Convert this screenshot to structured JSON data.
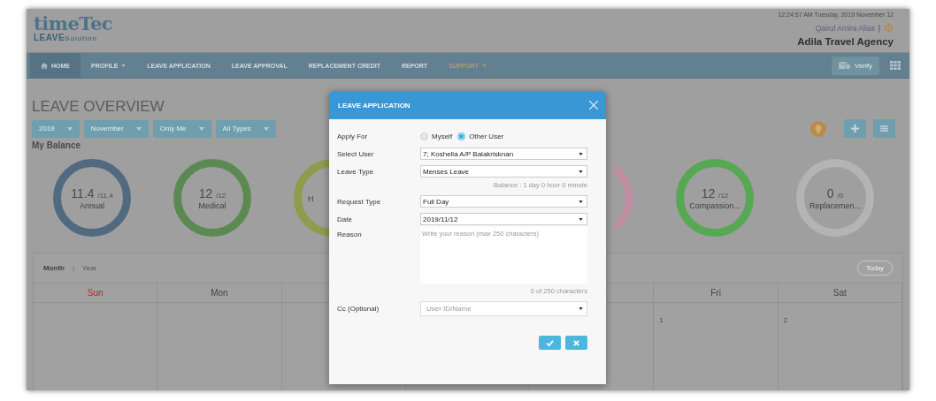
{
  "header": {
    "logo_top": "timeTec",
    "logo_bottom": "LEAVE",
    "logo_suffix": "Solution",
    "datetime": "12:24:57 AM Tuesday, 2019 November 12",
    "user": "Qairul Amira Alias",
    "separator": "|",
    "company": "Adila Travel Agency"
  },
  "nav": {
    "items": [
      {
        "label": "HOME",
        "selected": true,
        "kind": "home"
      },
      {
        "label": "PROFILE",
        "selected": false,
        "kind": "menu"
      },
      {
        "label": "LEAVE APPLICATION",
        "selected": false,
        "kind": "link"
      },
      {
        "label": "LEAVE APPROVAL",
        "selected": false,
        "kind": "link"
      },
      {
        "label": "REPLACEMENT CREDIT",
        "selected": false,
        "kind": "link"
      },
      {
        "label": "REPORT",
        "selected": false,
        "kind": "link"
      },
      {
        "label": "SUPPORT",
        "selected": false,
        "kind": "support"
      }
    ],
    "verify": "Verify"
  },
  "page": {
    "title": "LEAVE OVERVIEW",
    "filters": [
      "2019",
      "November",
      "Only Me",
      "All Types"
    ],
    "balance_title": "My Balance",
    "balances_left": [
      {
        "value": "11.4",
        "total": "/11.4",
        "label": "Annual",
        "color": "#526a80",
        "kind": "full"
      },
      {
        "value": "12",
        "total": "/12",
        "label": "Medical",
        "color": "#5a8a52",
        "kind": "full"
      },
      {
        "label": "H",
        "color": "#8e9c4e",
        "kind": "partial"
      }
    ],
    "balances_right": [
      {
        "color": "#c08ea3",
        "kind": "hidden"
      },
      {
        "value": "12",
        "total": "/12",
        "label": "Compassion...",
        "color": "#56a852",
        "kind": "full"
      },
      {
        "value": "0",
        "total": "/0",
        "label": "Replacemen...",
        "color": "#b4b4b4",
        "kind": "full"
      }
    ]
  },
  "calendar": {
    "views": [
      {
        "label": "Month",
        "selected": true
      },
      {
        "label": "Year",
        "selected": false
      }
    ],
    "separator": "|",
    "today": "Today",
    "days_left": [
      {
        "label": "Sun",
        "weekend": true
      },
      {
        "label": "Mon",
        "weekend": false
      }
    ],
    "days_right": [
      {
        "label": "Fri",
        "weekend": false,
        "date": "1"
      },
      {
        "label": "Sat",
        "weekend": false,
        "date": "2"
      }
    ]
  },
  "dialog": {
    "title": "LEAVE APPLICATION",
    "apply_for": {
      "label": "Apply For",
      "options": [
        {
          "label": "Myself",
          "selected": false,
          "disabled": true
        },
        {
          "label": "Other User",
          "selected": true,
          "disabled": false
        }
      ]
    },
    "fields": [
      {
        "label": "Select User",
        "value": "7; Koshella A/P Balakrisknan"
      },
      {
        "label": "Leave Type",
        "value": "Menses Leave",
        "note": "Balance : 1 day 0 hour 0 minute"
      },
      {
        "label": "Request Type",
        "value": "Full Day"
      },
      {
        "label": "Date",
        "value": "2019/11/12"
      }
    ],
    "reason": {
      "label": "Reason",
      "placeholder": "Write your reason (max 250 characters)",
      "counter": "0 of 250 characters"
    },
    "cc": {
      "label": "Cc (Optional)",
      "placeholder": "User ID/Name"
    }
  }
}
